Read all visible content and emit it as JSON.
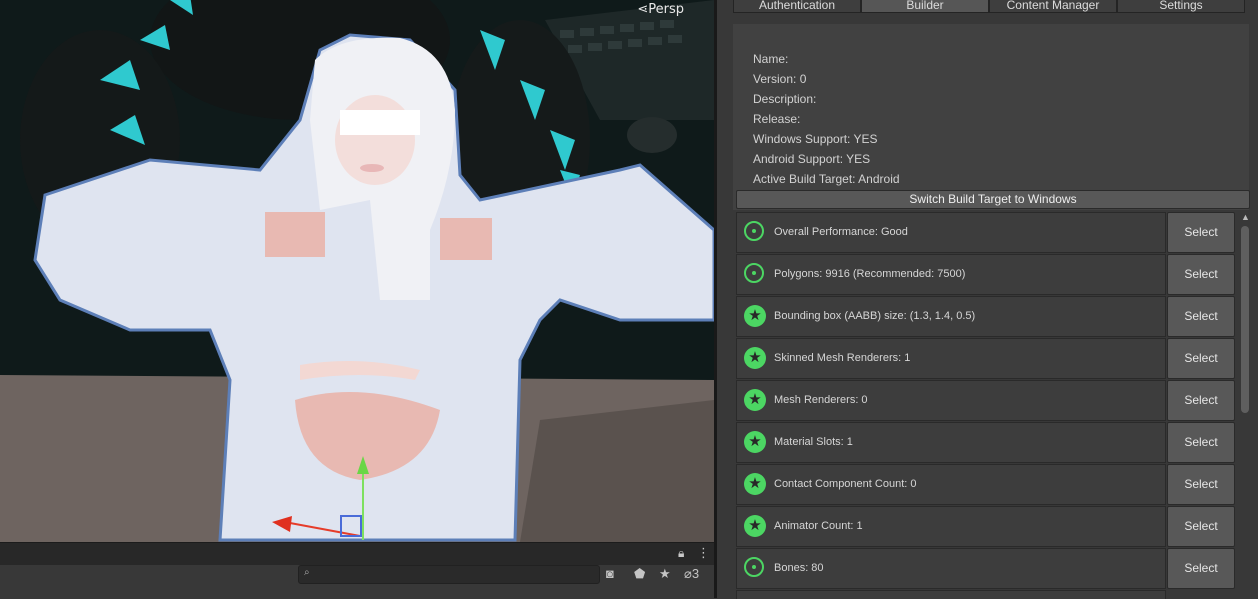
{
  "scene": {
    "projection_label": "⋖Persp"
  },
  "hierarchy_bar": {
    "lock_icon": "lock-icon",
    "search_placeholder": "",
    "hidden_count": "3"
  },
  "tabs": [
    {
      "label": "Authentication",
      "active": false
    },
    {
      "label": "Builder",
      "active": true
    },
    {
      "label": "Content Manager",
      "active": false
    },
    {
      "label": "Settings",
      "active": false
    }
  ],
  "info": {
    "name": "Name:",
    "version": "Version: 0",
    "description": "Description:",
    "release": "Release:",
    "windows_support": "Windows Support: YES",
    "android_support": "Android Support: YES",
    "active_build_target": "Active Build Target: Android",
    "switch_button": "Switch Build Target to Windows"
  },
  "rows": [
    {
      "icon": "good-ring-icon",
      "text": "Overall Performance: Good",
      "button": "Select"
    },
    {
      "icon": "good-ring-icon",
      "text": "Polygons: 9916 (Recommended: 7500)",
      "button": "Select"
    },
    {
      "icon": "star-icon",
      "text": "Bounding box (AABB) size: (1.3, 1.4, 0.5)",
      "button": "Select"
    },
    {
      "icon": "star-icon",
      "text": "Skinned Mesh Renderers: 1",
      "button": "Select"
    },
    {
      "icon": "star-icon",
      "text": "Mesh Renderers: 0",
      "button": "Select"
    },
    {
      "icon": "star-icon",
      "text": "Material Slots: 1",
      "button": "Select"
    },
    {
      "icon": "star-icon",
      "text": "Contact Component Count: 0",
      "button": "Select"
    },
    {
      "icon": "star-icon",
      "text": "Animator Count: 1",
      "button": "Select"
    },
    {
      "icon": "good-ring-icon",
      "text": "Bones: 80",
      "button": "Select"
    }
  ],
  "colors": {
    "good_green": "#4cd663",
    "panel_bg": "#383838",
    "button_bg": "#585858"
  }
}
